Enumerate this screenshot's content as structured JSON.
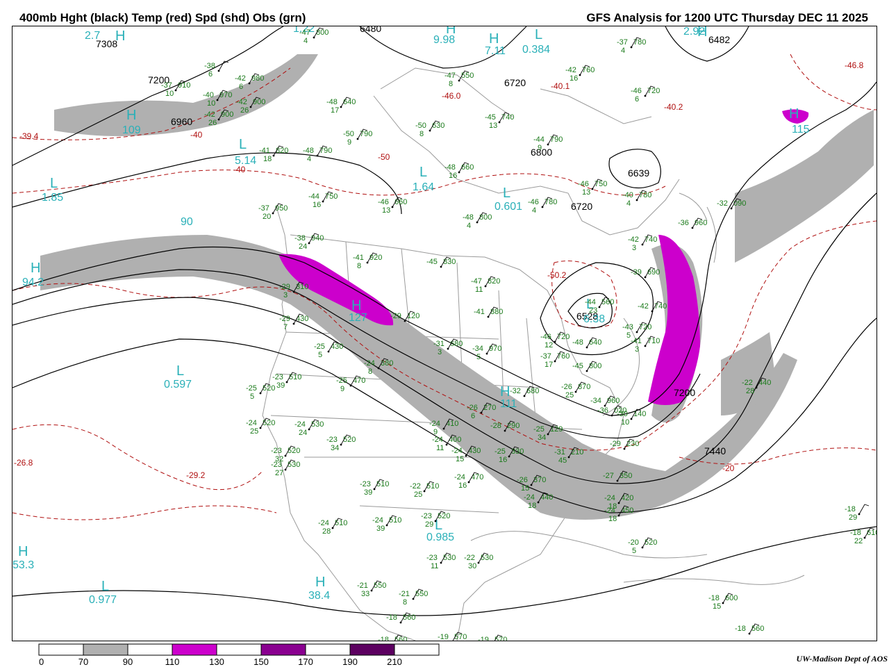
{
  "header": {
    "title_left": "400mb Hght (black) Temp (red) Spd (shd) Obs (grn)",
    "title_right": "GFS Analysis for 1200 UTC Thursday  DEC 11 2025"
  },
  "colors": {
    "height_contour": "#000000",
    "temp_contour": "#b01010",
    "obs_text": "#1a7a1a",
    "center_label": "#2ab0b8",
    "speed_70_90": "#b0b0b0",
    "speed_110_130": "#cc00cc",
    "speed_130_150": "#b000b0",
    "speed_150_170": "#8a0090",
    "speed_170_190": "#5c0060",
    "geography": "#9a9a9a"
  },
  "height_labels": [
    {
      "text": "7308"
    },
    {
      "text": "7200"
    },
    {
      "text": "6960"
    },
    {
      "text": "6480"
    },
    {
      "text": "6720"
    },
    {
      "text": "6800"
    },
    {
      "text": "6639"
    },
    {
      "text": "6720"
    },
    {
      "text": "6528"
    },
    {
      "text": "7200"
    },
    {
      "text": "7440"
    },
    {
      "text": "6482"
    }
  ],
  "temp_labels": [
    {
      "text": "-39.4"
    },
    {
      "text": "-40"
    },
    {
      "text": "-40"
    },
    {
      "text": "-46.0"
    },
    {
      "text": "-50"
    },
    {
      "text": "-50.2"
    },
    {
      "text": "-40.1"
    },
    {
      "text": "-40.2"
    },
    {
      "text": "-46.8"
    },
    {
      "text": "-26.8"
    },
    {
      "text": "-29.2"
    },
    {
      "text": "-20"
    }
  ],
  "centers": [
    {
      "letter": "H",
      "value": "2.7"
    },
    {
      "letter": "H",
      "value": "109"
    },
    {
      "letter": "L",
      "value": "5.14"
    },
    {
      "letter": "L",
      "value": "1.85"
    },
    {
      "letter": "H",
      "value": "94.2"
    },
    {
      "letter": "L",
      "value": "0.597"
    },
    {
      "letter": "H",
      "value": "127"
    },
    {
      "letter": "L",
      "value": "1.64"
    },
    {
      "letter": "L",
      "value": "0.601"
    },
    {
      "letter": "L",
      "value": "0.384"
    },
    {
      "letter": "H",
      "value": "111"
    },
    {
      "letter": "L",
      "value": "0.985"
    },
    {
      "letter": "H",
      "value": "38.4"
    },
    {
      "letter": "H",
      "value": "53.3"
    },
    {
      "letter": "L",
      "value": "0.977"
    },
    {
      "letter": "L",
      "value": "6.38"
    },
    {
      "letter": "H",
      "value": "115"
    },
    {
      "letter": "H",
      "value": "2.92"
    },
    {
      "letter": "H",
      "value": "9.98"
    },
    {
      "letter": "H",
      "value": "7.11"
    }
  ],
  "isolated_speed_labels": [
    {
      "text": "90"
    },
    {
      "text": "1.22"
    }
  ],
  "stations": [
    {
      "temp": "-47",
      "hgt": "800",
      "dew": "4"
    },
    {
      "temp": "-38",
      "hgt": "",
      "dew": "6"
    },
    {
      "temp": "-42",
      "hgt": "980",
      "dew": "6"
    },
    {
      "temp": "-37",
      "hgt": "910",
      "dew": "10"
    },
    {
      "temp": "-40",
      "hgt": "970",
      "dew": "10"
    },
    {
      "temp": "-42",
      "hgt": "900",
      "dew": "26"
    },
    {
      "temp": "-42",
      "hgt": "900",
      "dew": "26"
    },
    {
      "temp": "-47",
      "hgt": "550",
      "dew": "8"
    },
    {
      "temp": "-48",
      "hgt": "640",
      "dew": "17"
    },
    {
      "temp": "-50",
      "hgt": "790",
      "dew": "9"
    },
    {
      "temp": "-50",
      "hgt": "630",
      "dew": "8"
    },
    {
      "temp": "-45",
      "hgt": "740",
      "dew": "13"
    },
    {
      "temp": "-42",
      "hgt": "760",
      "dew": "16"
    },
    {
      "temp": "-37",
      "hgt": "780",
      "dew": "4"
    },
    {
      "temp": "-46",
      "hgt": "720",
      "dew": "6"
    },
    {
      "temp": "-44",
      "hgt": "790",
      "dew": "9"
    },
    {
      "temp": "-41",
      "hgt": "820",
      "dew": "18"
    },
    {
      "temp": "-48",
      "hgt": "790",
      "dew": "4"
    },
    {
      "temp": "-48",
      "hgt": "660",
      "dew": "16"
    },
    {
      "temp": "-46",
      "hgt": "750",
      "dew": "13"
    },
    {
      "temp": "-44",
      "hgt": "750",
      "dew": "16"
    },
    {
      "temp": "-46",
      "hgt": "660",
      "dew": "13"
    },
    {
      "temp": "-46",
      "hgt": "780",
      "dew": "4"
    },
    {
      "temp": "-40",
      "hgt": "780",
      "dew": "4"
    },
    {
      "temp": "-32",
      "hgt": "090",
      "dew": ""
    },
    {
      "temp": "-37",
      "hgt": "950",
      "dew": "20"
    },
    {
      "temp": "-48",
      "hgt": "800",
      "dew": "4"
    },
    {
      "temp": "-38",
      "hgt": "940",
      "dew": "24"
    },
    {
      "temp": "-41",
      "hgt": "920",
      "dew": "8"
    },
    {
      "temp": "-45",
      "hgt": "830",
      "dew": ""
    },
    {
      "temp": "-47",
      "hgt": "820",
      "dew": "11"
    },
    {
      "temp": "-42",
      "hgt": "740",
      "dew": "3"
    },
    {
      "temp": "-39",
      "hgt": "690",
      "dew": ""
    },
    {
      "temp": "-36",
      "hgt": "960",
      "dew": ""
    },
    {
      "temp": "-29",
      "hgt": "310",
      "dew": "3"
    },
    {
      "temp": "-29",
      "hgt": "430",
      "dew": "7"
    },
    {
      "temp": "-29",
      "hgt": "120",
      "dew": ""
    },
    {
      "temp": "-41",
      "hgt": "880",
      "dew": ""
    },
    {
      "temp": "-44",
      "hgt": "560",
      "dew": "23"
    },
    {
      "temp": "-42",
      "hgt": "740",
      "dew": ""
    },
    {
      "temp": "-43",
      "hgt": "720",
      "dew": "5"
    },
    {
      "temp": "-41",
      "hgt": "710",
      "dew": "3"
    },
    {
      "temp": "-46",
      "hgt": "720",
      "dew": "12"
    },
    {
      "temp": "-48",
      "hgt": "640",
      "dew": ""
    },
    {
      "temp": "-37",
      "hgt": "760",
      "dew": "17"
    },
    {
      "temp": "-31",
      "hgt": "680",
      "dew": "3"
    },
    {
      "temp": "-34",
      "hgt": "970",
      "dew": "5"
    },
    {
      "temp": "-25",
      "hgt": "430",
      "dew": "5"
    },
    {
      "temp": "-24",
      "hgt": "380",
      "dew": "8"
    },
    {
      "temp": "-23",
      "hgt": "510",
      "dew": "39"
    },
    {
      "temp": "-25",
      "hgt": "470",
      "dew": "9"
    },
    {
      "temp": "-25",
      "hgt": "520",
      "dew": "5"
    },
    {
      "temp": "-32",
      "hgt": "680",
      "dew": ""
    },
    {
      "temp": "-26",
      "hgt": "870",
      "dew": "25"
    },
    {
      "temp": "-34",
      "hgt": "960",
      "dew": ""
    },
    {
      "temp": "-36",
      "hgt": "020",
      "dew": ""
    },
    {
      "temp": "-30",
      "hgt": "140",
      "dew": "10"
    },
    {
      "temp": "-45",
      "hgt": "800",
      "dew": ""
    },
    {
      "temp": "-22",
      "hgt": "440",
      "dew": "28"
    },
    {
      "temp": "-24",
      "hgt": "520",
      "dew": "25"
    },
    {
      "temp": "-24",
      "hgt": "530",
      "dew": "24"
    },
    {
      "temp": "-23",
      "hgt": "520",
      "dew": "34"
    },
    {
      "temp": "-23",
      "hgt": "520",
      "dew": "32"
    },
    {
      "temp": "-23",
      "hgt": "530",
      "dew": "27"
    },
    {
      "temp": "-24",
      "hgt": "410",
      "dew": "9"
    },
    {
      "temp": "-24",
      "hgt": "400",
      "dew": "11"
    },
    {
      "temp": "-24",
      "hgt": "430",
      "dew": "15"
    },
    {
      "temp": "-24",
      "hgt": "470",
      "dew": "16"
    },
    {
      "temp": "-26",
      "hgt": "270",
      "dew": "6"
    },
    {
      "temp": "-28",
      "hgt": "290",
      "dew": ""
    },
    {
      "temp": "-25",
      "hgt": "330",
      "dew": "16"
    },
    {
      "temp": "-26",
      "hgt": "370",
      "dew": "15"
    },
    {
      "temp": "-31",
      "hgt": "210",
      "dew": "45"
    },
    {
      "temp": "-25",
      "hgt": "129",
      "dew": "34"
    },
    {
      "temp": "-29",
      "hgt": "230",
      "dew": ""
    },
    {
      "temp": "-27",
      "hgt": "350",
      "dew": ""
    },
    {
      "temp": "-24",
      "hgt": "420",
      "dew": "18"
    },
    {
      "temp": "-24",
      "hgt": "450",
      "dew": "18"
    },
    {
      "temp": "-24",
      "hgt": "440",
      "dew": "18"
    },
    {
      "temp": "-23",
      "hgt": "510",
      "dew": "39"
    },
    {
      "temp": "-22",
      "hgt": "510",
      "dew": "25"
    },
    {
      "temp": "-24",
      "hgt": "510",
      "dew": "28"
    },
    {
      "temp": "-24",
      "hgt": "510",
      "dew": "39"
    },
    {
      "temp": "-23",
      "hgt": "520",
      "dew": "29"
    },
    {
      "temp": "-23",
      "hgt": "530",
      "dew": "11"
    },
    {
      "temp": "-22",
      "hgt": "530",
      "dew": "30"
    },
    {
      "temp": "-21",
      "hgt": "550",
      "dew": "33"
    },
    {
      "temp": "-21",
      "hgt": "550",
      "dew": "8"
    },
    {
      "temp": "-18",
      "hgt": "560",
      "dew": ""
    },
    {
      "temp": "-18",
      "hgt": "560",
      "dew": ""
    },
    {
      "temp": "-19",
      "hgt": "570",
      "dew": "9"
    },
    {
      "temp": "-19",
      "hgt": "570",
      "dew": ""
    },
    {
      "temp": "-18",
      "hgt": "560",
      "dew": ""
    },
    {
      "temp": "-20",
      "hgt": "520",
      "dew": "5"
    },
    {
      "temp": "-18",
      "hgt": "600",
      "dew": "15"
    },
    {
      "temp": "-18",
      "hgt": "610",
      "dew": "22"
    },
    {
      "temp": "-18",
      "hgt": "",
      "dew": "29"
    }
  ],
  "colorbar": {
    "ticks": [
      "0",
      "70",
      "90",
      "110",
      "130",
      "150",
      "170",
      "190",
      "210"
    ],
    "fills": [
      "#ffffff",
      "#b0b0b0",
      "#ffffff",
      "#cc00cc",
      "#ffffff",
      "#8a0090",
      "#ffffff",
      "#5c0060",
      "#ffffff"
    ]
  },
  "credit": "UW-Madison  Dept of AOS"
}
